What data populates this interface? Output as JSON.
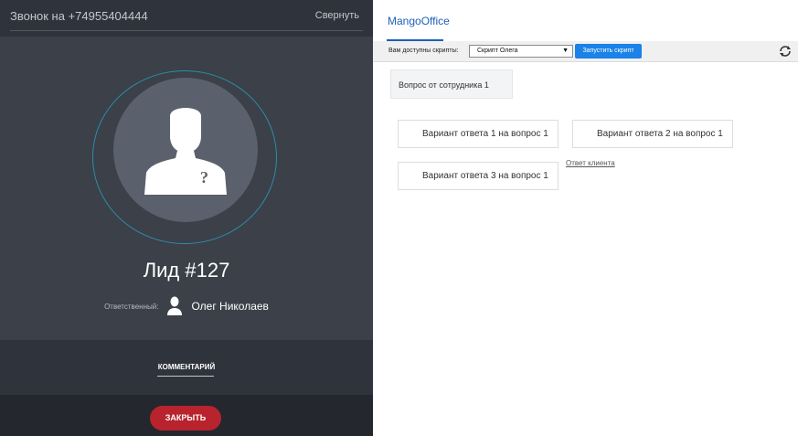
{
  "call_panel": {
    "phone_label": "Звонок на +74955404444",
    "collapse_label": "Свернуть",
    "lead_title": "Лид #127",
    "responsible_label": "Ответственный:",
    "responsible_name": "Олег Николаев",
    "comment_label": "КОММЕНТАРИЙ",
    "close_label": "ЗАКРЫТЬ",
    "colors": {
      "bg": "#3b4049",
      "dark": "#2f333b",
      "close": "#b8232d",
      "ring": "#2c8ea7"
    }
  },
  "script_panel": {
    "tab_label": "MangoOffice",
    "scripts_label": "Вам доступны скрипты:",
    "selected_script": "Скрипт Олега",
    "run_label": "Запустить скрипт",
    "question": "Вопрос от сотрудника 1",
    "answers": [
      "Вариант ответа 1 на вопрос 1",
      "Вариант ответа 2 на вопрос 1",
      "Вариант ответа 3 на вопрос 1"
    ],
    "client_answer_link": "Ответ клиента",
    "colors": {
      "accent": "#1e5fb9",
      "run_button": "#1a82e8"
    }
  }
}
